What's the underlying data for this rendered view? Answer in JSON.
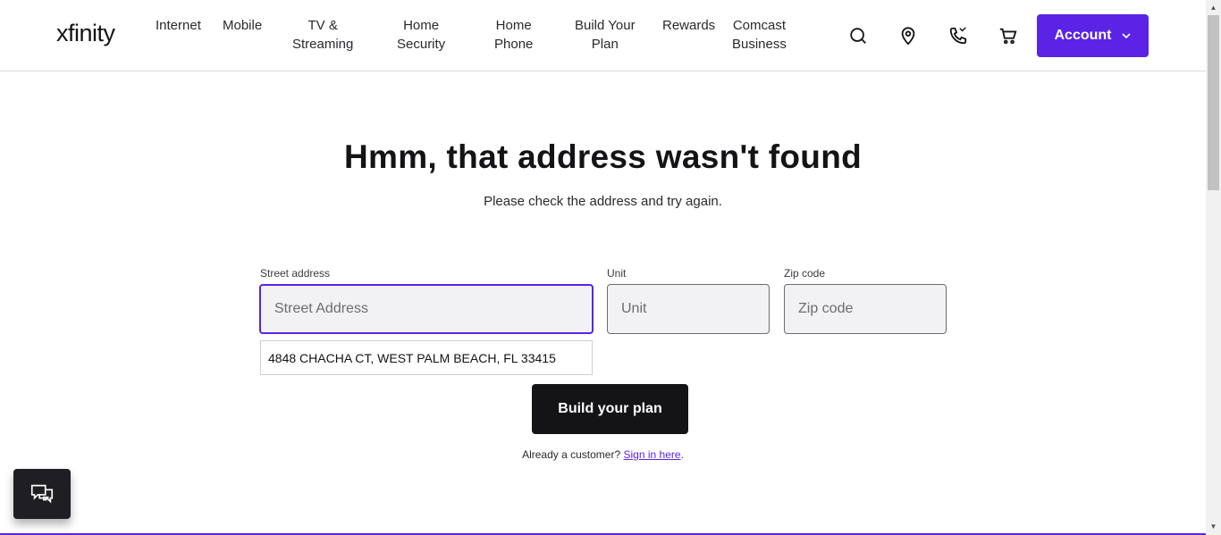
{
  "header": {
    "logo": "xfinity",
    "nav": [
      {
        "line1": "Internet",
        "line2": ""
      },
      {
        "line1": "Mobile",
        "line2": ""
      },
      {
        "line1": "TV &",
        "line2": "Streaming"
      },
      {
        "line1": "Home",
        "line2": "Security"
      },
      {
        "line1": "Home",
        "line2": "Phone"
      },
      {
        "line1": "Build Your",
        "line2": "Plan"
      },
      {
        "line1": "Rewards",
        "line2": ""
      },
      {
        "line1": "Comcast",
        "line2": "Business"
      }
    ],
    "icons": [
      "search-icon",
      "location-pin-icon",
      "phone-icon",
      "cart-icon"
    ],
    "account_label": "Account"
  },
  "main": {
    "title": "Hmm, that address wasn't found",
    "subtitle": "Please check the address and try again.",
    "street": {
      "label": "Street address",
      "placeholder": "Street Address",
      "value": ""
    },
    "unit": {
      "label": "Unit",
      "placeholder": "Unit",
      "value": ""
    },
    "zip": {
      "label": "Zip code",
      "placeholder": "Zip code",
      "value": ""
    },
    "suggestion": "4848 CHACHA CT, WEST PALM BEACH, FL 33415",
    "build_button": "Build your plan",
    "customer_text": "Already a customer?",
    "sign_in_link": "Sign in here",
    "customer_suffix": "."
  },
  "colors": {
    "accent": "#5a23e6",
    "dark": "#141417",
    "field_bg": "#f2f2f4"
  },
  "chat": {
    "icon": "chat-icon"
  }
}
